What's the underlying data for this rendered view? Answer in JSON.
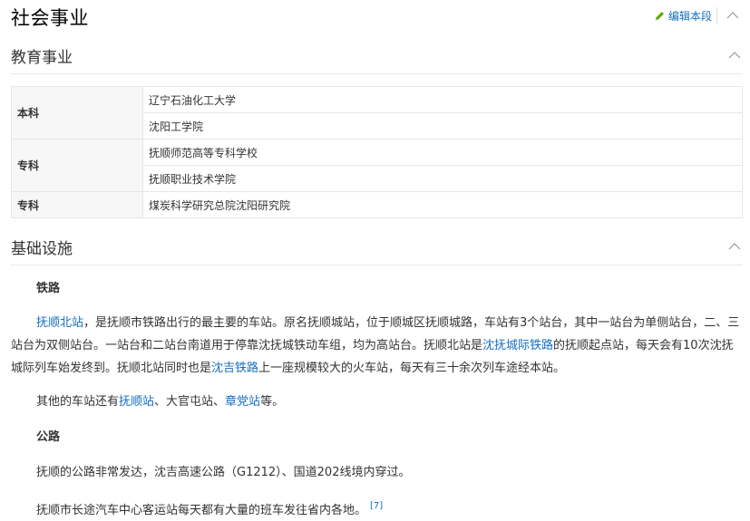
{
  "section": {
    "title": "社会事业",
    "edit_label": "编辑本段"
  },
  "education": {
    "title": "教育事业",
    "rows": [
      {
        "key": "本科",
        "values": [
          "辽宁石油化工大学",
          "沈阳工学院"
        ]
      },
      {
        "key": "专科",
        "values": [
          "抚顺师范高等专科学校",
          "抚顺职业技术学院"
        ]
      },
      {
        "key": "专科",
        "values": [
          "煤炭科学研究总院沈阳研究院"
        ]
      }
    ]
  },
  "infrastructure": {
    "title": "基础设施",
    "railway": {
      "heading": "铁路",
      "p1_link1": "抚顺北站",
      "p1_t1": "，是抚顺市铁路出行的最主要的车站。原名抚顺城站，位于顺城区抚顺城路，车站有3个站台，其中一站台为单侧站台，二、三站台为双侧站台。一站台和二站台南道用于停靠沈抚城铁动车组，均为高站台。抚顺北站是",
      "p1_link2": "沈抚城际铁路",
      "p1_t2": "的抚顺起点站，每天会有10次沈抚城际列车始发终到。抚顺北站同时也是",
      "p1_link3": "沈吉铁路",
      "p1_t3": "上一座规模较大的火车站，每天有三十余次列车途经本站。",
      "p2_t1": "其他的车站还有",
      "p2_link1": "抚顺站",
      "p2_t2": "、大官屯站、",
      "p2_link2": "章党站",
      "p2_t3": "等。"
    },
    "road": {
      "heading": "公路",
      "p1": "抚顺的公路非常发达，沈吉高速公路（G1212）、国道202线境内穿过。",
      "p2": "抚顺市长途汽车中心客运站每天都有大量的班车发往省内各地。",
      "ref": "[7]"
    }
  }
}
